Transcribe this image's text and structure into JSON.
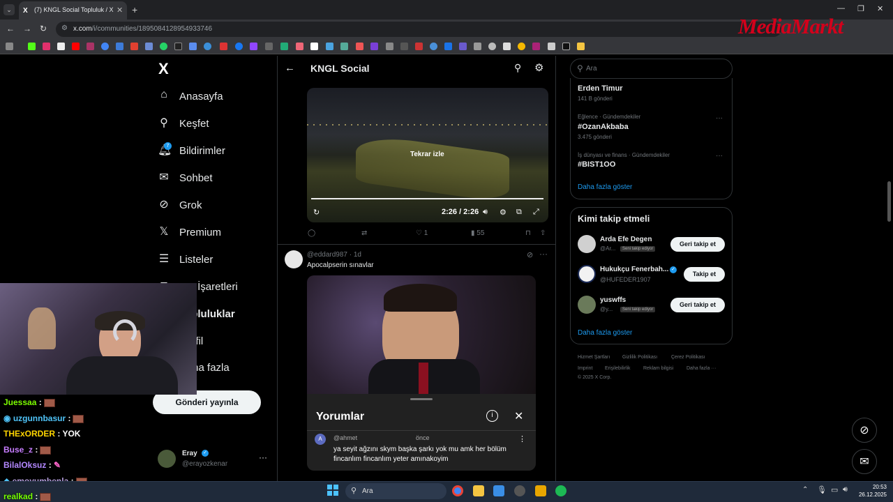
{
  "browser": {
    "tab_title": "(7) KNGL Social Topluluk / X",
    "tab_favicon": "X",
    "new_tab": "+",
    "url_host": "x.com",
    "url_path": "/i/communities/1895084128954933746",
    "watermark": "MediaMarkt"
  },
  "sidebar": {
    "logo": "X",
    "items": [
      {
        "label": "Anasayfa",
        "icon": "home-icon"
      },
      {
        "label": "Keşfet",
        "icon": "search-icon"
      },
      {
        "label": "Bildirimler",
        "icon": "bell-icon",
        "badge": "7"
      },
      {
        "label": "Sohbet",
        "icon": "mail-icon"
      },
      {
        "label": "Grok",
        "icon": "grok-icon"
      },
      {
        "label": "Premium",
        "icon": "x-premium-icon"
      },
      {
        "label": "Listeler",
        "icon": "list-icon"
      },
      {
        "label": "Yer İşaretleri",
        "icon": "bookmark-icon"
      },
      {
        "label": "Topluluklar",
        "icon": "communities-icon"
      },
      {
        "label": "Profil",
        "icon": "profile-icon"
      },
      {
        "label": "Daha fazla",
        "icon": "more-icon"
      }
    ],
    "post_button": "Gönderi yayınla",
    "account": {
      "name": "Eray",
      "handle": "@erayozkenar",
      "more": "···"
    }
  },
  "community": {
    "title": "KNGL Social",
    "video1": {
      "replay_label": "Tekrar izle",
      "time": "2:26 / 2:26",
      "likes": "1",
      "views": "55"
    },
    "post2": {
      "handle": "@eddard987",
      "age": "1d",
      "text": "Apocalpserin sınavlar"
    },
    "comments": {
      "title": "Yorumlar",
      "author": "@ahmet",
      "author_initial": "A",
      "time_suffix": "önce",
      "text": "ya seyit ağzını skym başka şarkı yok mu amk her bölüm fincanlım fincanlım yeter amınakoyim"
    }
  },
  "right": {
    "search_placeholder": "Ara",
    "trends": [
      {
        "category": "",
        "name": "Erden Timur",
        "count": "141 B gönderi"
      },
      {
        "category": "Eğlence · Gündemdekiler",
        "name": "#OzanAkbaba",
        "count": "3.475 gönderi"
      },
      {
        "category": "İş dünyası ve finans · Gündemdekiler",
        "name": "#BIST1OO",
        "count": ""
      }
    ],
    "trends_more": "Daha fazla göster",
    "who_title": "Kimi takip etmeli",
    "who": [
      {
        "name": "Arda Efe Degen",
        "handle": "@Ar...",
        "chip": "Seni takip ediyor",
        "button": "Geri takip et"
      },
      {
        "name": "Hukukçu Fenerbah...",
        "handle": "@HUFEDER1907",
        "chip": "",
        "button": "Takip et"
      },
      {
        "name": "yuswffs",
        "handle": "@y...",
        "chip": "Seni takip ediyor",
        "button": "Geri takip et"
      }
    ],
    "who_more": "Daha fazla göster",
    "footer": [
      "Hizmet Şartları",
      "Gizlilik Politikası",
      "Çerez Politikası",
      "Imprint",
      "Erişilebilirlik",
      "Reklam bilgisi",
      "Daha fazla ···",
      "© 2025 X Corp."
    ]
  },
  "chat": [
    {
      "user": "Juessaa",
      "color": "#7cfc00",
      "message": "",
      "emote": true
    },
    {
      "user": "uzgunnbasur",
      "color": "#4fc3f7",
      "message": "",
      "emote": true
    },
    {
      "user": "THExORDER",
      "color": "#ffd600",
      "message": "YOK",
      "emote": false
    },
    {
      "user": "Buse_z",
      "color": "#c77dff",
      "message": "",
      "emote": true
    },
    {
      "user": "BilalOksuz",
      "color": "#b388ff",
      "message": "",
      "emote": true
    },
    {
      "user": "emoyumbenla",
      "color": "#b39ddb",
      "message": "",
      "emote": true
    },
    {
      "user": "realkad",
      "color": "#76ff03",
      "message": "",
      "emote": true
    }
  ],
  "taskbar": {
    "search": "Ara",
    "time": "20:53",
    "date": "26.12.2025"
  },
  "colors": {
    "accent": "#1d9bf0",
    "background": "#000000",
    "border": "#2f3336",
    "muted": "#71767b"
  }
}
